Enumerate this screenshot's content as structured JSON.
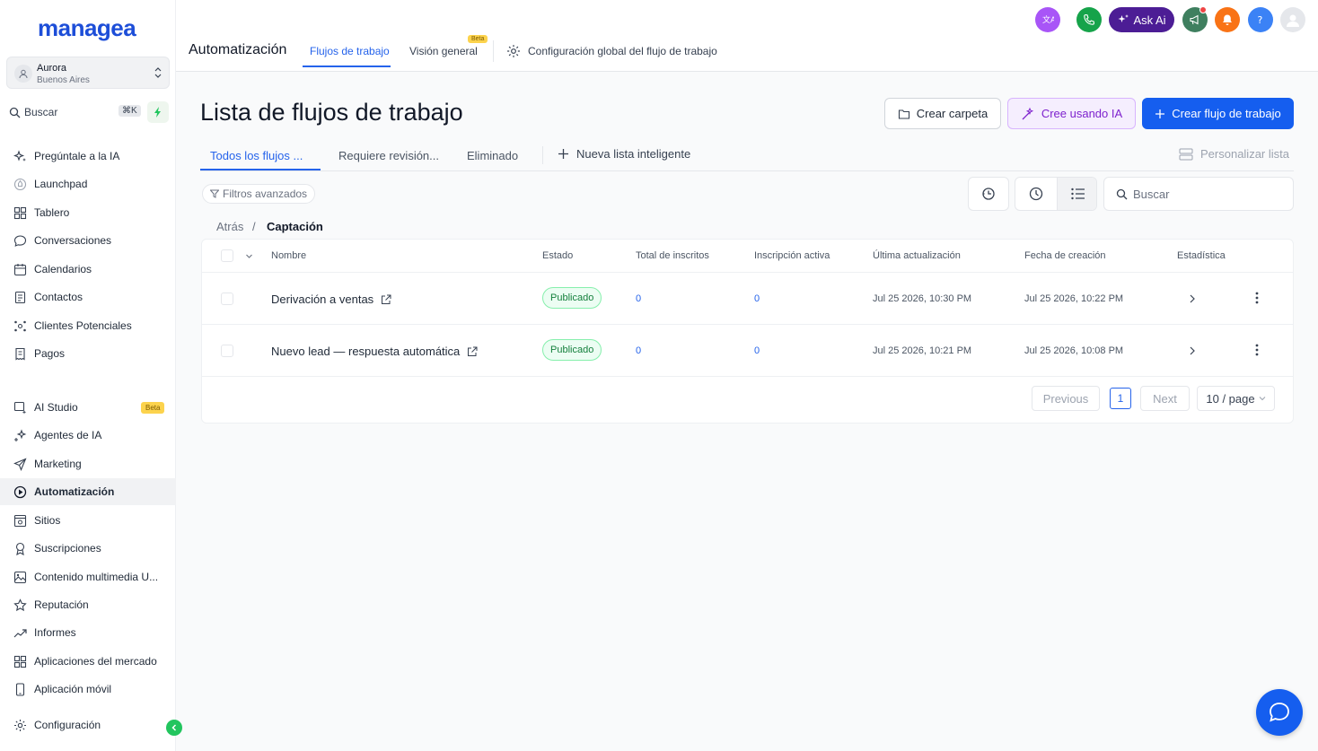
{
  "brand": {
    "logo_text": "managea",
    "accent": "#155eef"
  },
  "location": {
    "name": "Aurora",
    "city": "Buenos Aires"
  },
  "sidebar_search": {
    "label": "Buscar",
    "shortcut": "⌘K"
  },
  "sidebar": {
    "items": [
      {
        "label": "Pregúntale a la IA",
        "icon": "sparkle-icon"
      },
      {
        "label": "Launchpad",
        "icon": "rocket-icon"
      },
      {
        "label": "Tablero",
        "icon": "grid-icon"
      },
      {
        "label": "Conversaciones",
        "icon": "chat-bubble-icon"
      },
      {
        "label": "Calendarios",
        "icon": "calendar-icon"
      },
      {
        "label": "Contactos",
        "icon": "contact-book-icon"
      },
      {
        "label": "Clientes Potenciales",
        "icon": "network-icon"
      },
      {
        "label": "Pagos",
        "icon": "receipt-icon"
      }
    ],
    "items2": [
      {
        "label": "AI Studio",
        "icon": "ai-studio-icon",
        "badge": "Beta"
      },
      {
        "label": "Agentes de IA",
        "icon": "sparkle-plus-icon"
      },
      {
        "label": "Marketing",
        "icon": "send-icon"
      },
      {
        "label": "Automatización",
        "icon": "automation-icon",
        "active": true
      },
      {
        "label": "Sitios",
        "icon": "website-icon"
      },
      {
        "label": "Suscripciones",
        "icon": "award-icon"
      },
      {
        "label": "Contenido multimedia U...",
        "icon": "image-icon"
      },
      {
        "label": "Reputación",
        "icon": "star-icon"
      },
      {
        "label": "Informes",
        "icon": "trend-icon"
      },
      {
        "label": "Aplicaciones del mercado",
        "icon": "apps-icon"
      },
      {
        "label": "Aplicación móvil",
        "icon": "mobile-icon"
      }
    ],
    "settings": "Configuración"
  },
  "header": {
    "section": "Automatización",
    "tabs": [
      {
        "label": "Flujos de trabajo",
        "active": true
      },
      {
        "label": "Visión general",
        "badge": "Beta"
      },
      {
        "label": "Configuración global del flujo de trabajo"
      }
    ],
    "ask_ai": "Ask Ai"
  },
  "main": {
    "title": "Lista de flujos de trabajo",
    "buttons": {
      "create_folder": "Crear carpeta",
      "create_ai": "Cree usando IA",
      "create_workflow": "Crear flujo de trabajo"
    },
    "list_tabs": [
      {
        "label": "Todos los flujos ...",
        "active": true
      },
      {
        "label": "Requiere revisión..."
      },
      {
        "label": "Eliminado"
      }
    ],
    "new_smart_list": "Nueva lista inteligente",
    "customize_list": "Personalizar lista",
    "advanced_filters": "Filtros avanzados",
    "search_placeholder": "Buscar",
    "breadcrumb": {
      "back": "Atrás",
      "separator": "/",
      "current": "Captación"
    }
  },
  "table": {
    "columns": [
      "Nombre",
      "Estado",
      "Total de inscritos",
      "Inscripción activa",
      "Última actualización",
      "Fecha de creación",
      "Estadística"
    ],
    "rows": [
      {
        "name": "Derivación a ventas",
        "status": "Publicado",
        "total": "0",
        "active": "0",
        "updated": "Jul 25 2026, 10:30 PM",
        "created": "Jul 25 2026, 10:22 PM"
      },
      {
        "name": "Nuevo lead — respuesta automática",
        "status": "Publicado",
        "total": "0",
        "active": "0",
        "updated": "Jul 25 2026, 10:21 PM",
        "created": "Jul 25 2026, 10:08 PM"
      }
    ]
  },
  "pagination": {
    "previous": "Previous",
    "page": "1",
    "next": "Next",
    "page_size": "10 / page"
  }
}
